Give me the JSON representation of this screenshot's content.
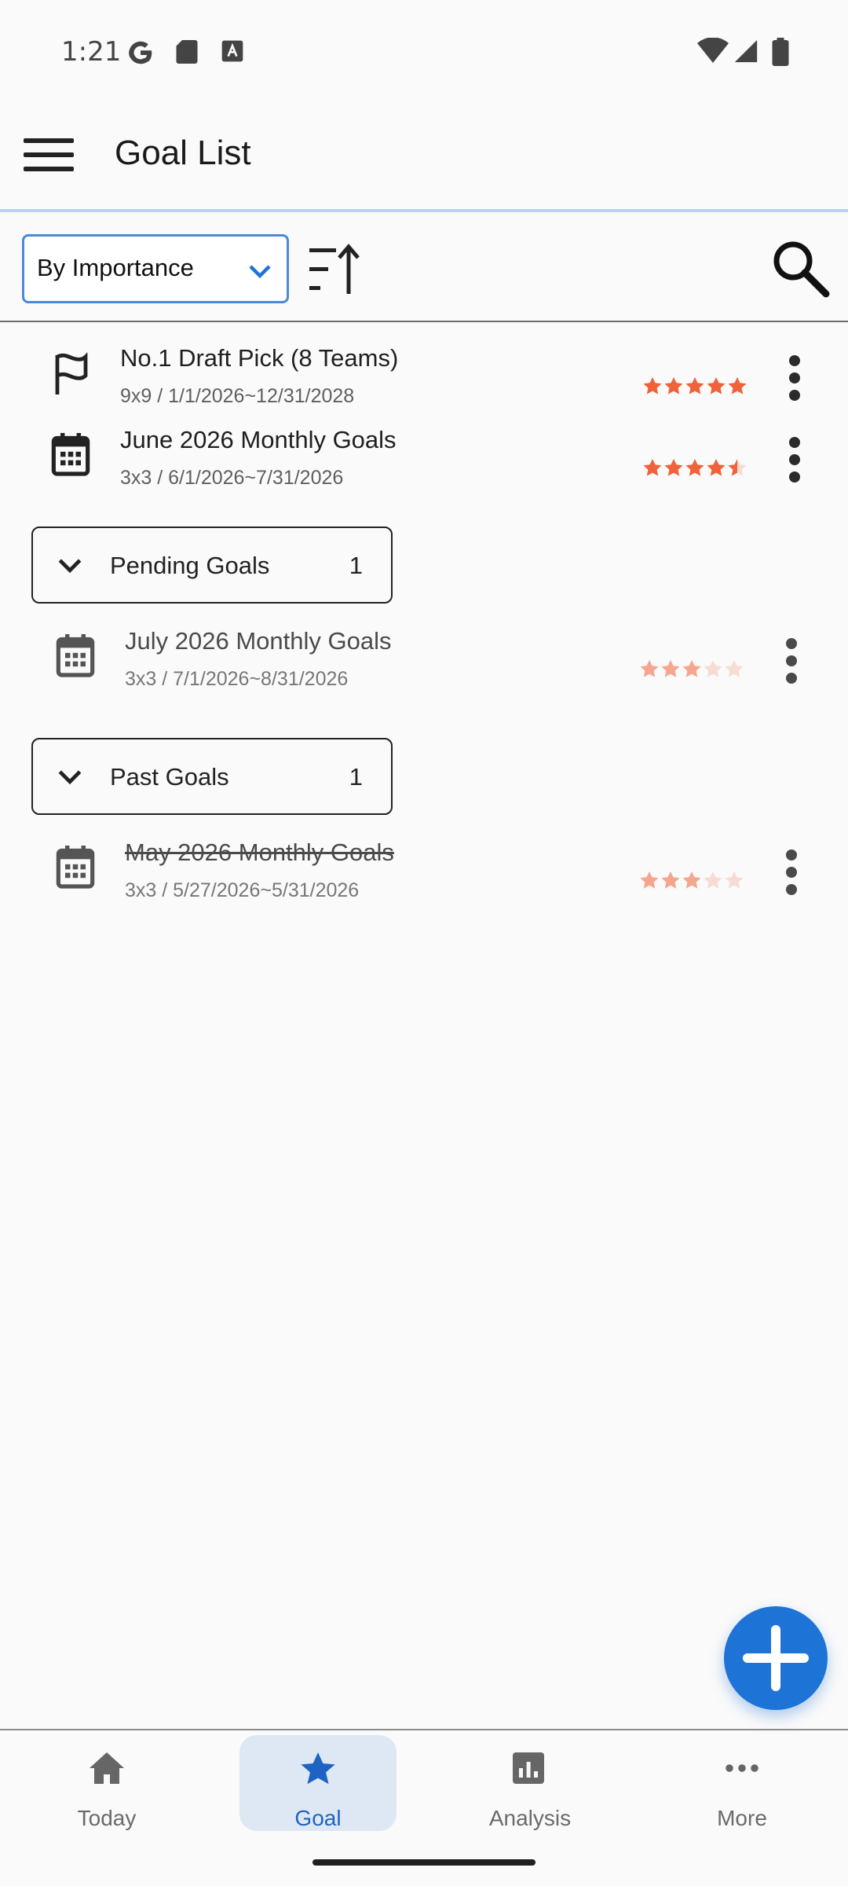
{
  "status_bar": {
    "time": "1:21",
    "icons": [
      "google-g-icon",
      "sd-card-icon",
      "font-a-icon",
      "wifi-icon",
      "signal-icon",
      "battery-icon"
    ]
  },
  "app_bar": {
    "title": "Goal List",
    "menu_icon": "hamburger-menu-icon"
  },
  "toolbar": {
    "sort_selected": "By Importance",
    "sort_icon": "sort-ascending-icon",
    "search_icon": "search-icon"
  },
  "goals": [
    {
      "title": "No.1 Draft Pick (8 Teams)",
      "meta": "9x9 / 1/1/2026~12/31/2028",
      "icon": "flag-icon",
      "rating": 5
    },
    {
      "title": "June 2026 Monthly Goals",
      "meta": "3x3 / 6/1/2026~7/31/2026",
      "icon": "calendar-icon",
      "rating": 4.5
    }
  ],
  "sections": {
    "pending": {
      "label": "Pending Goals",
      "count": "1",
      "items": [
        {
          "title": "July 2026 Monthly Goals",
          "meta": "3x3 / 7/1/2026~8/31/2026",
          "icon": "calendar-icon",
          "rating": 3
        }
      ]
    },
    "past": {
      "label": "Past Goals",
      "count": "1",
      "items": [
        {
          "title": "May 2026 Monthly Goals",
          "meta": "3x3 / 5/27/2026~5/31/2026",
          "icon": "calendar-icon",
          "rating": 3
        }
      ]
    }
  },
  "fab": {
    "icon": "plus-icon"
  },
  "bottom_nav": [
    {
      "label": "Today",
      "icon": "home-icon",
      "active": false
    },
    {
      "label": "Goal",
      "icon": "star-icon",
      "active": true
    },
    {
      "label": "Analysis",
      "icon": "bar-chart-icon",
      "active": false
    },
    {
      "label": "More",
      "icon": "more-horizontal-icon",
      "active": false
    }
  ],
  "colors": {
    "accent": "#1e74d6",
    "star": "#f0623a",
    "star_faded": "#f5a68e",
    "star_empty": "#f6dcd3",
    "active_nav_bg": "#dde8f4"
  }
}
